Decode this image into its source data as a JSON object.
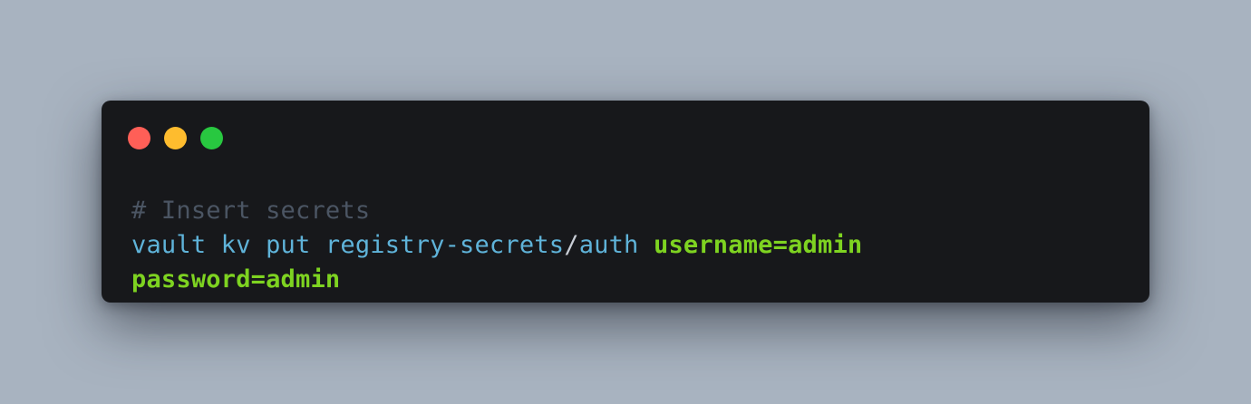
{
  "window": {
    "controls": {
      "close_color": "#ff5f57",
      "minimize_color": "#febc2e",
      "maximize_color": "#28c840"
    },
    "background_color": "#17181b"
  },
  "code": {
    "comment": "# Insert secrets",
    "command_part1": "vault kv put registry-secrets",
    "separator": "/",
    "command_part2": "auth",
    "arg_username": "username=admin",
    "arg_password": "password=admin"
  },
  "colors": {
    "comment": "#4b5563",
    "command": "#5fb3d9",
    "argument": "#7ed321",
    "page_background": "#a8b3c0"
  }
}
